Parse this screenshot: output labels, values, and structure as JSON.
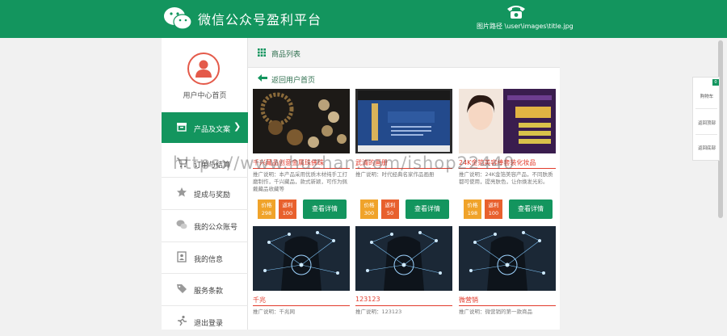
{
  "header": {
    "title": "微信公众号盈利平台",
    "image_path_label": "图片路径 \\user\\images\\title.jpg",
    "logo_icon": "wechat-icon",
    "phone_icon": "phone-icon"
  },
  "sidebar": {
    "user_center": "用户中心首页",
    "items": [
      {
        "label": "产品及文案",
        "icon": "box-icon",
        "active": true
      },
      {
        "label": "订单与结算",
        "icon": "cart-icon",
        "active": false
      },
      {
        "label": "提成与奖励",
        "icon": "star-icon",
        "active": false
      },
      {
        "label": "我的公众账号",
        "icon": "chat-icon",
        "active": false
      },
      {
        "label": "我的信息",
        "icon": "profile-icon",
        "active": false
      },
      {
        "label": "服务条款",
        "icon": "tag-icon",
        "active": false
      },
      {
        "label": "退出登录",
        "icon": "run-icon",
        "active": false
      }
    ]
  },
  "main": {
    "section_title": "商品列表",
    "back_label": "返回用户首页",
    "price_label": "价格",
    "rebate_label": "返利",
    "detail_label": "查看详情",
    "cards": [
      {
        "name": "千兴藏品创意金属珠佛珠",
        "desc": "推广说明：本产品采用优质木材纯手工打磨制作，千兴藏品，款式新颖，可作为佩戴藏品收藏等",
        "price": "298",
        "rebate": "100",
        "has_buttons": true
      },
      {
        "name": "武清的画册",
        "desc": "推广说明：时代经典名家作品画册",
        "price": "300",
        "rebate": "50",
        "has_buttons": true
      },
      {
        "name": "24K金箔美容棒套装化妆品",
        "desc": "推广说明：24K金箔美容产品，不同肤质都可使用，提亮肤色，让你焕发光彩。",
        "price": "198",
        "rebate": "100",
        "has_buttons": true
      },
      {
        "name": "千兆",
        "desc": "推广说明：千兆网",
        "price": "",
        "rebate": "",
        "has_buttons": false
      },
      {
        "name": "123123",
        "desc": "推广说明：123123",
        "price": "",
        "rebate": "",
        "has_buttons": false
      },
      {
        "name": "微营销",
        "desc": "推广说明：微营销的第一款商品",
        "price": "",
        "rebate": "",
        "has_buttons": false
      }
    ]
  },
  "float_panel": {
    "badge": "0",
    "items": [
      "购物车",
      "返回顶部",
      "返回底部"
    ]
  },
  "watermark": "https://www.huzhan.com/ishop22440",
  "colors": {
    "brand_green": "#13955e",
    "price_orange": "#f0a32a",
    "rebate_orange": "#e8602d",
    "title_red": "#e23b2c"
  }
}
